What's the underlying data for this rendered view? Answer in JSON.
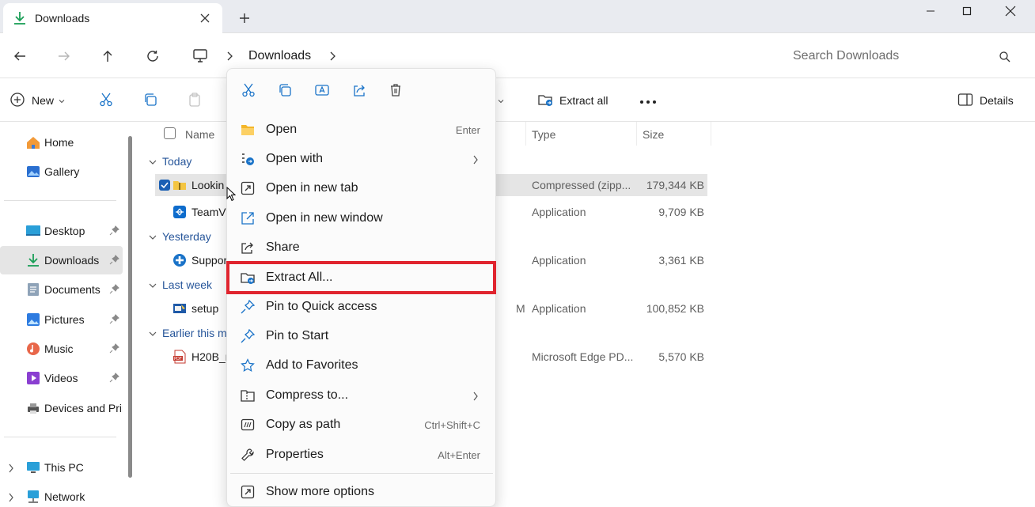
{
  "window": {
    "tab_title": "Downloads",
    "tab_icon": "download-arrow-icon",
    "new_tab_icon": "plus-icon",
    "controls": [
      "minimize-icon",
      "maximize-icon",
      "close-icon"
    ]
  },
  "address": {
    "breadcrumb": [
      "This PC",
      "Downloads"
    ],
    "current": "Downloads",
    "search_placeholder": "Search Downloads"
  },
  "toolbar": {
    "new_label": "New",
    "extract_all_label": "Extract all",
    "details_label": "Details",
    "accent_color": "#1a73c8"
  },
  "sidebar": {
    "quick": [
      {
        "label": "Home",
        "icon": "home-icon"
      },
      {
        "label": "Gallery",
        "icon": "gallery-icon"
      }
    ],
    "pinned": [
      {
        "label": "Desktop",
        "icon": "desktop-icon",
        "pinned": true
      },
      {
        "label": "Downloads",
        "icon": "download-arrow-icon",
        "pinned": true,
        "active": true
      },
      {
        "label": "Documents",
        "icon": "documents-icon",
        "pinned": true
      },
      {
        "label": "Pictures",
        "icon": "pictures-icon",
        "pinned": true
      },
      {
        "label": "Music",
        "icon": "music-icon",
        "pinned": true
      },
      {
        "label": "Videos",
        "icon": "videos-icon",
        "pinned": true
      },
      {
        "label": "Devices and Prir",
        "icon": "printer-icon",
        "pinned": false
      }
    ],
    "tree": [
      {
        "label": "This PC",
        "icon": "computer-icon"
      },
      {
        "label": "Network",
        "icon": "network-icon"
      }
    ]
  },
  "filelist": {
    "columns": {
      "name": "Name",
      "type": "Type",
      "size": "Size"
    },
    "groups": [
      {
        "label": "Today",
        "rows": [
          {
            "name": "Lookin",
            "type": "Compressed (zipp...",
            "size": "179,344 KB",
            "selected": true,
            "icon": "zip-folder-icon"
          },
          {
            "name": "TeamV",
            "type": "Application",
            "size": "9,709 KB",
            "icon": "teamviewer-icon"
          }
        ]
      },
      {
        "label": "Yesterday",
        "rows": [
          {
            "name": "Suppor",
            "type": "Application",
            "size": "3,361 KB",
            "icon": "support-icon"
          }
        ]
      },
      {
        "label": "Last week",
        "rows": [
          {
            "name": "setup",
            "type": "Application",
            "size": "100,852 KB",
            "icon": "setup-icon",
            "date_fragment": "M"
          }
        ]
      },
      {
        "label": "Earlier this m",
        "rows": [
          {
            "name": "H20B_r",
            "type": "Microsoft Edge PD...",
            "size": "5,570 KB",
            "icon": "pdf-icon"
          }
        ]
      }
    ]
  },
  "context_menu": {
    "quick_actions": [
      "cut-icon",
      "copy-icon",
      "rename-icon",
      "share-icon",
      "delete-icon"
    ],
    "items": [
      {
        "label": "Open",
        "shortcut": "Enter",
        "icon": "folder-icon"
      },
      {
        "label": "Open with",
        "submenu": true,
        "icon": "open-with-icon"
      },
      {
        "label": "Open in new tab",
        "icon": "new-tab-icon"
      },
      {
        "label": "Open in new window",
        "icon": "new-window-icon"
      },
      {
        "label": "Share",
        "icon": "share-icon"
      },
      {
        "label": "Extract All...",
        "icon": "extract-icon",
        "highlighted": true
      },
      {
        "label": "Pin to Quick access",
        "icon": "pin-icon"
      },
      {
        "label": "Pin to Start",
        "icon": "pin-icon"
      },
      {
        "label": "Add to Favorites",
        "icon": "star-icon"
      },
      {
        "label": "Compress to...",
        "submenu": true,
        "icon": "compress-icon"
      },
      {
        "label": "Copy as path",
        "shortcut": "Ctrl+Shift+C",
        "icon": "copy-path-icon"
      },
      {
        "label": "Properties",
        "shortcut": "Alt+Enter",
        "icon": "wrench-icon"
      }
    ],
    "footer": {
      "label": "Show more options",
      "icon": "more-options-icon"
    },
    "highlight_color": "#e0242e"
  }
}
